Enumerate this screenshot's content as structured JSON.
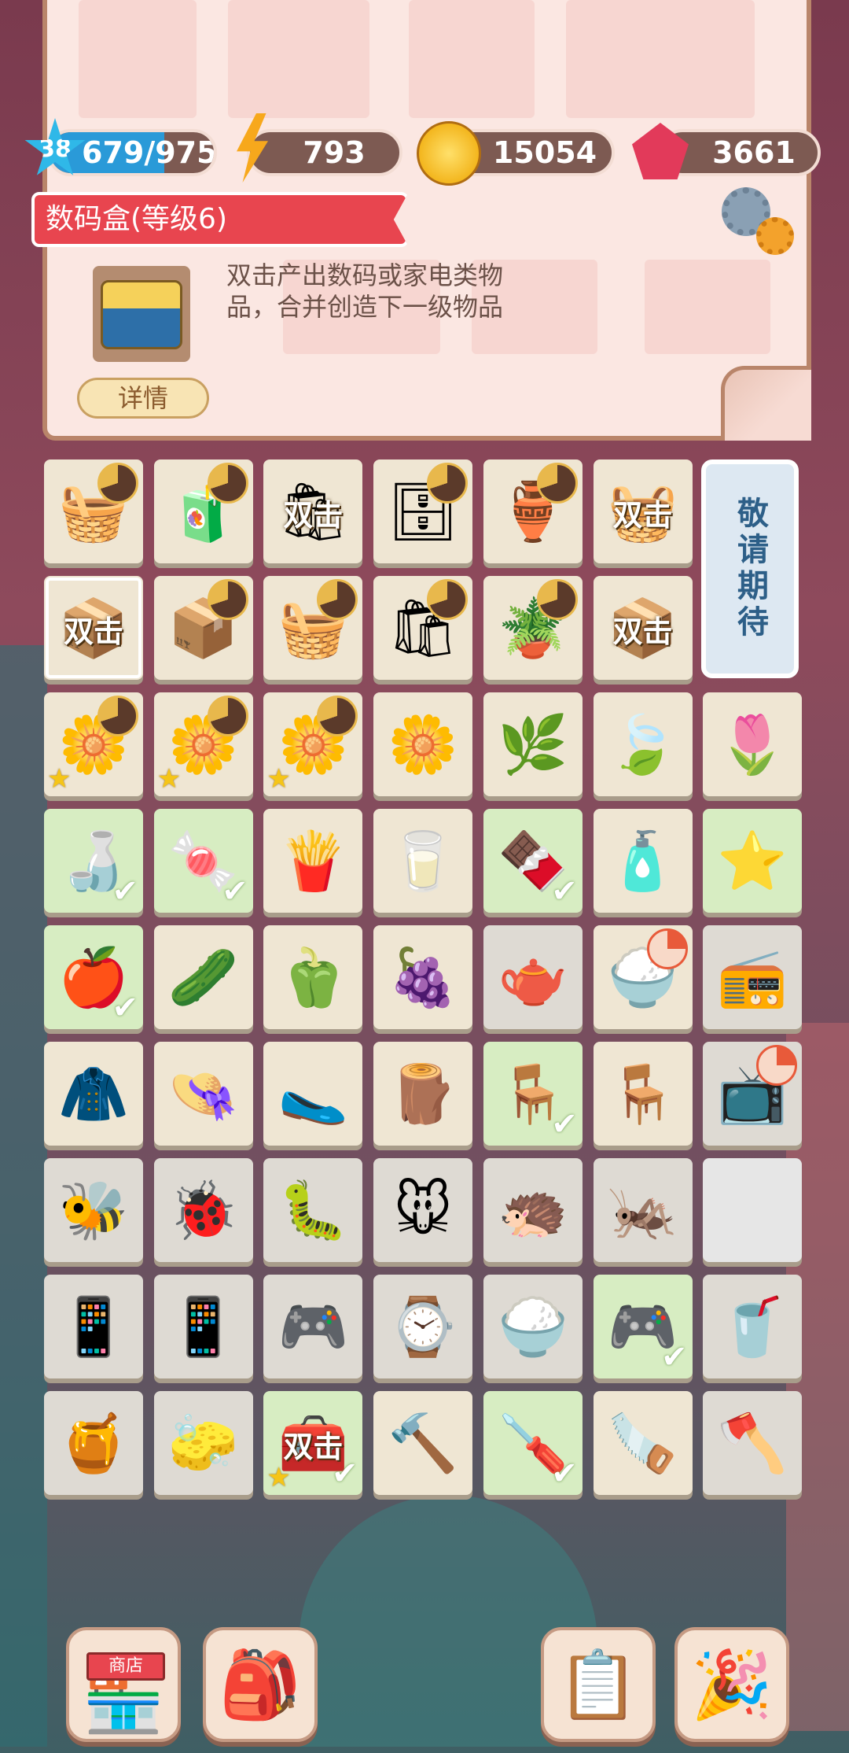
{
  "stats": {
    "level": "38",
    "xp": "679/975",
    "xp_progress": 0.696,
    "energy": "793",
    "coins": "15054",
    "gems": "3661"
  },
  "info": {
    "title": "数码盒(等级6)",
    "description_line1": "双击产出数码或家电类物",
    "description_line2": "品，合并创造下一级物品",
    "detail_label": "详情"
  },
  "board": {
    "coming_soon": "敬请期待",
    "double_tap_label": "双击",
    "rows": [
      [
        {
          "name": "fruit-basket",
          "icon": "🧺",
          "timer": true
        },
        {
          "name": "grocery-box",
          "icon": "🧃",
          "timer": true
        },
        {
          "name": "shopping-bags-double-tap",
          "label": "双击",
          "icon": "🛍"
        },
        {
          "name": "shelf-unit",
          "icon": "🗄",
          "timer": true
        },
        {
          "name": "clay-pot",
          "icon": "🏺",
          "timer": true
        },
        {
          "name": "basket-double-tap",
          "label": "双击",
          "icon": "🧺"
        }
      ],
      [
        {
          "name": "digital-box-double-tap",
          "label": "双击",
          "icon": "📦",
          "selected": true
        },
        {
          "name": "snack-box",
          "icon": "📦",
          "timer": true
        },
        {
          "name": "wicker-basket",
          "icon": "🧺",
          "timer": true
        },
        {
          "name": "shopping-bags",
          "icon": "🛍",
          "timer": true
        },
        {
          "name": "plant-pot",
          "icon": "🪴",
          "timer": true
        },
        {
          "name": "digital-box-blue-double-tap",
          "label": "双击",
          "icon": "📦"
        }
      ],
      [
        {
          "name": "daisy-flower-star",
          "icon": "🌼",
          "timer": true,
          "star": true
        },
        {
          "name": "daisy-flower-star",
          "icon": "🌼",
          "timer": true,
          "star": true
        },
        {
          "name": "daisy-flower-star",
          "icon": "🌼",
          "timer": true,
          "star": true
        },
        {
          "name": "daisy-flower",
          "icon": "🌼"
        },
        {
          "name": "green-bush",
          "icon": "🌿"
        },
        {
          "name": "green-leaf",
          "icon": "🍃"
        },
        {
          "name": "flower-bud",
          "icon": "🌷"
        }
      ],
      [
        {
          "name": "sauce-bottle",
          "icon": "🍶",
          "check": true,
          "bg": "green"
        },
        {
          "name": "candy",
          "icon": "🍬",
          "check": true,
          "bg": "green"
        },
        {
          "name": "chips-bag",
          "icon": "🍟"
        },
        {
          "name": "milk-bottle",
          "icon": "🥛"
        },
        {
          "name": "snack-pack",
          "icon": "🍫",
          "check": true,
          "bg": "green"
        },
        {
          "name": "water-bottle",
          "icon": "🧴"
        },
        {
          "name": "blue-star",
          "icon": "⭐",
          "bg": "green"
        }
      ],
      [
        {
          "name": "apple",
          "icon": "🍎",
          "check": true,
          "bg": "green"
        },
        {
          "name": "cucumber",
          "icon": "🥒"
        },
        {
          "name": "green-pepper",
          "icon": "🫑"
        },
        {
          "name": "grapes",
          "icon": "🍇"
        },
        {
          "name": "electric-kettle",
          "icon": "🫖",
          "bg": "gray"
        },
        {
          "name": "rice-cooker-bubble",
          "icon": "🍚",
          "redtimer": true
        },
        {
          "name": "radio",
          "icon": "📻",
          "bg": "gray"
        }
      ],
      [
        {
          "name": "trench-coat",
          "icon": "🧥"
        },
        {
          "name": "purple-hat",
          "icon": "👒"
        },
        {
          "name": "slippers",
          "icon": "🥿"
        },
        {
          "name": "firewood",
          "icon": "🪵"
        },
        {
          "name": "white-chair",
          "icon": "🪑",
          "check": true,
          "bg": "green"
        },
        {
          "name": "wooden-stool",
          "icon": "🪑"
        },
        {
          "name": "microwave-bubble",
          "icon": "📺",
          "redtimer": true,
          "bg": "gray"
        }
      ],
      [
        {
          "name": "bee",
          "icon": "🐝",
          "bg": "gray"
        },
        {
          "name": "ladybug",
          "icon": "🐞",
          "bg": "gray"
        },
        {
          "name": "caterpillar",
          "icon": "🐛",
          "bg": "gray"
        },
        {
          "name": "mouse",
          "icon": "🐭",
          "bg": "gray"
        },
        {
          "name": "hedgehog",
          "icon": "🦔",
          "bg": "gray"
        },
        {
          "name": "grasshopper",
          "icon": "🦗",
          "bg": "gray"
        },
        {
          "name": "empty-slot",
          "icon": "",
          "empty": true
        }
      ],
      [
        {
          "name": "small-phone",
          "icon": "📱",
          "bg": "gray"
        },
        {
          "name": "smartphone",
          "icon": "📱",
          "bg": "gray"
        },
        {
          "name": "game-console",
          "icon": "🎮",
          "bg": "gray"
        },
        {
          "name": "smart-band",
          "icon": "⌚",
          "bg": "gray"
        },
        {
          "name": "rice-cooker",
          "icon": "🍚",
          "bg": "gray"
        },
        {
          "name": "gamepad",
          "icon": "🎮",
          "check": true,
          "bg": "green"
        },
        {
          "name": "blender",
          "icon": "🥤",
          "bg": "gray"
        }
      ],
      [
        {
          "name": "honey-jar",
          "icon": "🍯",
          "bg": "gray"
        },
        {
          "name": "sponge",
          "icon": "🧽",
          "bg": "gray"
        },
        {
          "name": "toolbox-double-tap",
          "label": "双击",
          "icon": "🧰",
          "check": true,
          "star": true,
          "bg": "green"
        },
        {
          "name": "hammer",
          "icon": "🔨"
        },
        {
          "name": "screwdriver",
          "icon": "🪛",
          "check": true,
          "bg": "green"
        },
        {
          "name": "saw",
          "icon": "🪚"
        },
        {
          "name": "axe",
          "icon": "🪓",
          "bg": "gray"
        }
      ]
    ]
  },
  "bottom_bar": {
    "shop_sign": "商店"
  }
}
